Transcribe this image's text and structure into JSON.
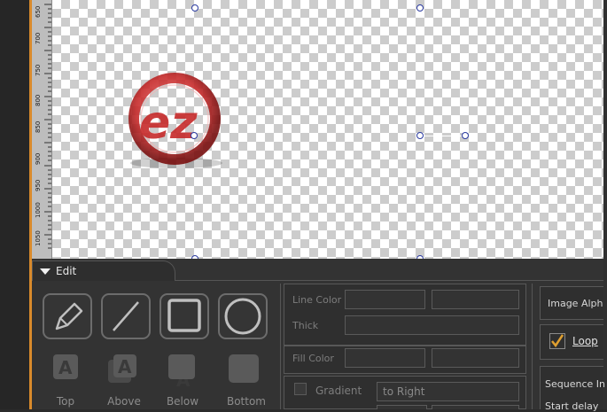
{
  "ruler": {
    "labels": [
      "650",
      "700",
      "750",
      "800",
      "850",
      "900",
      "950",
      "1000",
      "1050"
    ]
  },
  "edit_tab": {
    "label": "Edit"
  },
  "tools": [
    {
      "name": "pencil-icon"
    },
    {
      "name": "line-icon"
    },
    {
      "name": "rectangle-icon"
    },
    {
      "name": "ellipse-icon"
    }
  ],
  "layer_buttons": [
    {
      "label": "Top"
    },
    {
      "label": "Above"
    },
    {
      "label": "Below"
    },
    {
      "label": "Bottom"
    }
  ],
  "properties": {
    "line_color_label": "Line Color",
    "thick_label": "Thick",
    "fill_color_label": "Fill Color",
    "gradient_label": "Gradient",
    "gradient_value": "to Right"
  },
  "right_panel": {
    "image_alpha_label": "Image Alph",
    "loop_label": "Loop",
    "loop_checked": true,
    "sequence_label": "Sequence In",
    "start_delay_label": "Start delay"
  },
  "colors": {
    "accent": "#d98a2b",
    "logo_red": "#c62a2a",
    "panel_bg": "#333333"
  }
}
